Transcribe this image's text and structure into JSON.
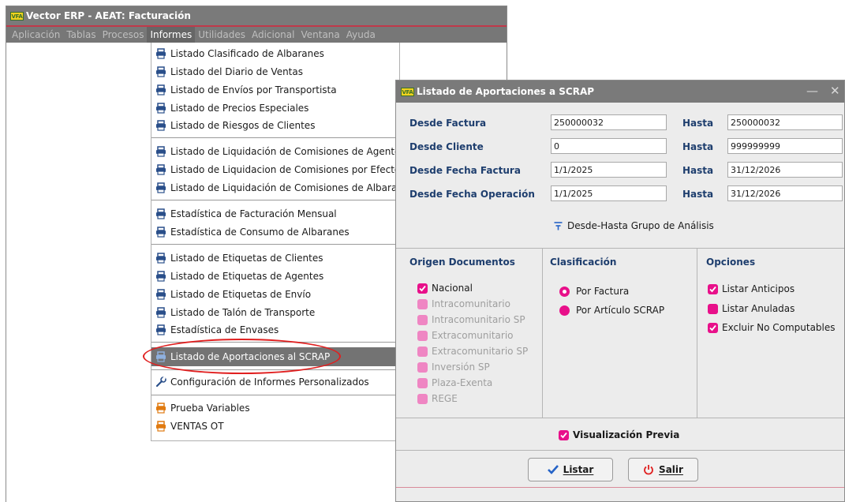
{
  "main_window": {
    "logo": "VFA",
    "title": "Vector ERP - AEAT: Facturación"
  },
  "menubar": [
    "Aplicación",
    "Tablas",
    "Procesos",
    "Informes",
    "Utilidades",
    "Adicional",
    "Ventana",
    "Ayuda"
  ],
  "dropdown": {
    "items": [
      "Listado Clasificado de Albaranes",
      "Listado del Diario de Ventas",
      "Listado de Envíos por Transportista",
      "Listado de Precios Especiales",
      "Listado de Riesgos de Clientes",
      "Listado de Liquidación de Comisiones de Agente",
      "Listado de Liquidacion de Comisiones por Efectos de",
      "Listado de Liquidación de Comisiones de Albaranes",
      "Estadística de Facturación Mensual",
      "Estadística de Consumo de Albaranes",
      "Listado de Etiquetas de Clientes",
      "Listado de Etiquetas de Agentes",
      "Listado de Etiquetas de Envío",
      "Listado de Talón de Transporte",
      "Estadística de Envases",
      "Listado de Aportaciones al SCRAP",
      "Configuración de Informes Personalizados",
      "Prueba Variables",
      "VENTAS OT"
    ],
    "icons": {
      "printer": "printer-icon",
      "wrench": "wrench-icon"
    },
    "colors": {
      "printer_blue": "#2a4f8a",
      "printer_orange": "#e07a10"
    }
  },
  "dialog": {
    "logo": "VFA",
    "title": "Listado de Aportaciones a SCRAP",
    "hasta_label": "Hasta",
    "rows": [
      {
        "label": "Desde Factura",
        "desde": "250000032",
        "hasta": "250000032"
      },
      {
        "label": "Desde Cliente",
        "desde": "0",
        "hasta": "999999999"
      },
      {
        "label": "Desde Fecha Factura",
        "desde": "1/1/2025",
        "hasta": "31/12/2026"
      },
      {
        "label": "Desde Fecha Operación",
        "desde": "1/1/2025",
        "hasta": "31/12/2026"
      }
    ],
    "grupo_link": "Desde-Hasta Grupo de Análisis",
    "origen": {
      "title": "Origen Documentos",
      "options": [
        {
          "label": "Nacional",
          "checked": true,
          "enabled": true
        },
        {
          "label": "Intracomunitario",
          "checked": false,
          "enabled": false
        },
        {
          "label": "Intracomunitario SP",
          "checked": false,
          "enabled": false
        },
        {
          "label": "Extracomunitario",
          "checked": false,
          "enabled": false
        },
        {
          "label": "Extracomunitario SP",
          "checked": false,
          "enabled": false
        },
        {
          "label": "Inversión SP",
          "checked": false,
          "enabled": false
        },
        {
          "label": "Plaza-Exenta",
          "checked": false,
          "enabled": false
        },
        {
          "label": "REGE",
          "checked": false,
          "enabled": false
        }
      ]
    },
    "clasificacion": {
      "title": "Clasificación",
      "options": [
        {
          "label": "Por Factura",
          "selected": true
        },
        {
          "label": "Por Artículo SCRAP",
          "selected": false
        }
      ]
    },
    "opciones": {
      "title": "Opciones",
      "options": [
        {
          "label": "Listar Anticipos",
          "checked": true
        },
        {
          "label": "Listar Anuladas",
          "checked": false
        },
        {
          "label": "Excluir No Computables",
          "checked": true
        }
      ]
    },
    "visualizacion": {
      "label": "Visualización Previa",
      "checked": true
    },
    "buttons": {
      "listar": "Listar",
      "salir": "Salir"
    },
    "colors": {
      "accent_pink": "#e8108a",
      "label_blue": "#1e3e6e",
      "listar_icon": "#2563c7",
      "salir_icon": "#e02020"
    }
  }
}
